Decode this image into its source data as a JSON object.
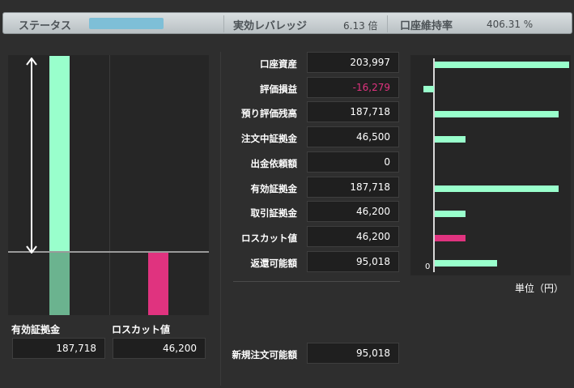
{
  "header": {
    "status_label": "ステータス",
    "leverage_label": "実効レバレッジ",
    "leverage_value": "6.13 倍",
    "margin_ratio_label": "口座維持率",
    "margin_ratio_value": "406.31 %"
  },
  "left_panel": {
    "effective_margin_label": "有効証拠金",
    "effective_margin_value": "187,718",
    "losscut_label": "ロスカット値",
    "losscut_value": "46,200"
  },
  "rows": [
    {
      "label": "口座資産",
      "value": "203,997"
    },
    {
      "label": "評価損益",
      "value": "-16,279"
    },
    {
      "label": "預り評価残高",
      "value": "187,718"
    },
    {
      "label": "注文中証拠金",
      "value": "46,500"
    },
    {
      "label": "出金依頼額",
      "value": "0"
    },
    {
      "label": "有効証拠金",
      "value": "187,718"
    },
    {
      "label": "取引証拠金",
      "value": "46,200"
    },
    {
      "label": "ロスカット値",
      "value": "46,200"
    },
    {
      "label": "返還可能額",
      "value": "95,018"
    }
  ],
  "new_order": {
    "label": "新規注文可能額",
    "value": "95,018"
  },
  "right_chart": {
    "zero_label": "0",
    "unit_label": "単位（円）"
  },
  "chart_data": {
    "type": "bar",
    "orientation": "horizontal",
    "categories": [
      "口座資産",
      "評価損益",
      "預り評価残高",
      "注文中証拠金",
      "出金依頼額",
      "有効証拠金",
      "取引証拠金",
      "ロスカット値",
      "返還可能額"
    ],
    "values": [
      203997,
      -16279,
      187718,
      46500,
      0,
      187718,
      46200,
      46200,
      95018
    ],
    "colors": [
      "#99ffcc",
      "#99ffcc",
      "#99ffcc",
      "#99ffcc",
      "#99ffcc",
      "#99ffcc",
      "#99ffcc",
      "#e0337f",
      "#99ffcc"
    ]
  },
  "left_chart_data": {
    "type": "bar",
    "categories": [
      "有効証拠金",
      "ロスカット値"
    ],
    "values": [
      187718,
      46200
    ],
    "colors": [
      "#99ffcc",
      "#e0337f"
    ]
  },
  "colors": {
    "positive": "#99ffcc",
    "negative": "#e0337f",
    "status_fill": "#7ebfd7"
  }
}
